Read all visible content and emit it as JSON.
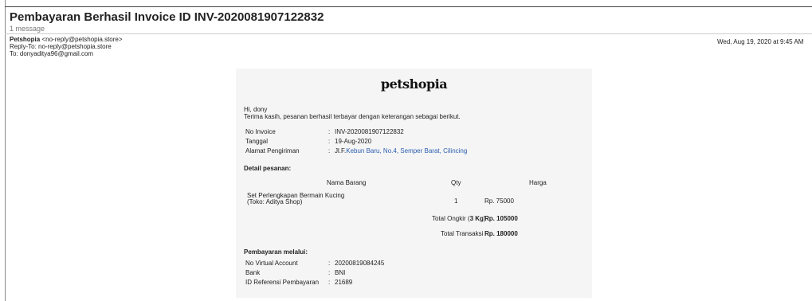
{
  "email": {
    "subject": "Pembayaran Berhasil Invoice ID INV-2020081907122832",
    "message_count": "1 message",
    "from_name": "Petshopia",
    "from_address": "<no-reply@petshopia.store>",
    "reply_to": "Reply-To: no-reply@petshopia.store",
    "to": "To: donyaditya96@gmail.com",
    "date": "Wed, Aug 19, 2020 at 9:45 AM"
  },
  "body": {
    "logo_text": "petshopia",
    "greeting": "Hi, dony",
    "intro": "Terima kasih, pesanan berhasil terbayar dengan keterangan sebagai berikut.",
    "separator": ":",
    "invoice_label": "No Invoice",
    "invoice_value": "INV-2020081907122832",
    "date_label": "Tanggal",
    "date_value": "19-Aug-2020",
    "address_label": "Alamat Pengiriman",
    "address_prefix": "Jl.F.",
    "address_link": "Kebun Baru, No.4, Semper Barat, Cilincing",
    "detail_heading": "Detail pesanan:",
    "columns": {
      "item": "Nama Barang",
      "qty": "Qty",
      "price": "Harga"
    },
    "item_name_line1": "Set Perlengkapan Bermain Kucing",
    "item_name_line2": "(Toko: Aditya Shop)",
    "item_qty": "1",
    "item_price": "Rp. 75000",
    "shipping_label": "Total Ongkir (",
    "shipping_weight": "3 Kg",
    "shipping_close": ")",
    "shipping_value": "Rp. 105000",
    "total_label": "Total Transaksi",
    "total_value": "Rp. 180000",
    "payment_heading": "Pembayaran melalui:",
    "va_label": "No Virtual Account",
    "va_value": "20200819084245",
    "bank_label": "Bank",
    "bank_value": "BNI",
    "ref_label": "ID Referensi Pembayaran",
    "ref_value": "21689"
  }
}
